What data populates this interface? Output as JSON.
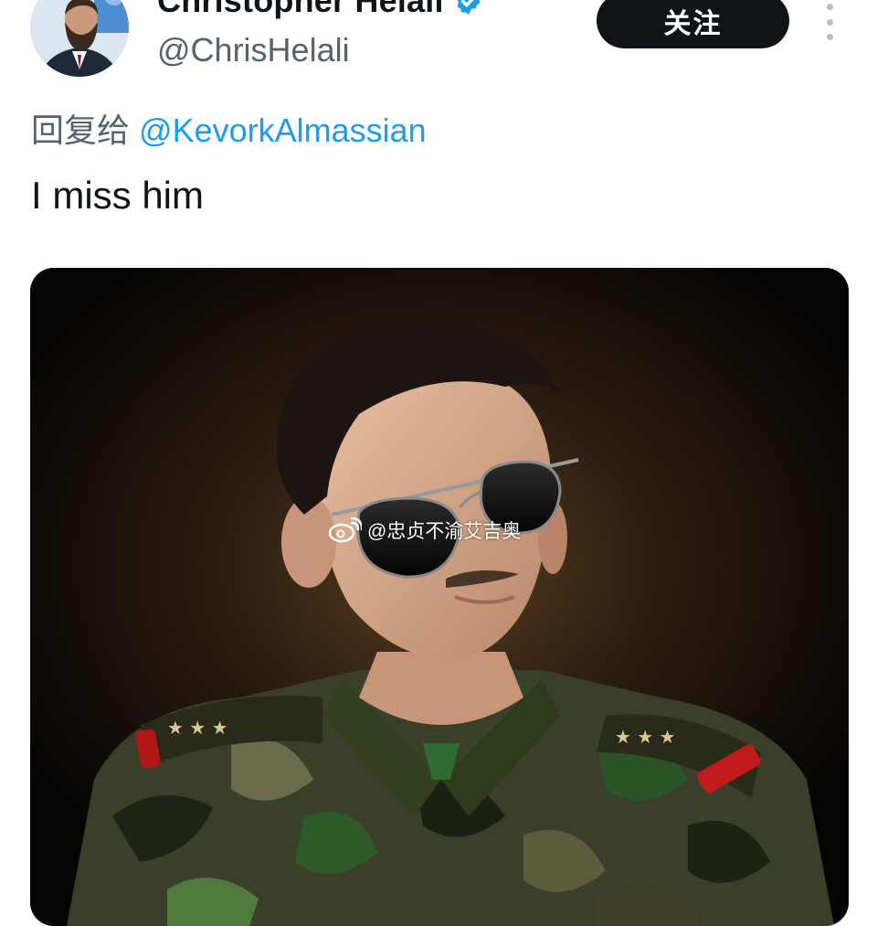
{
  "author": {
    "name": "Christopher Helali",
    "handle": "@ChrisHelali",
    "verified": true
  },
  "actions": {
    "follow_label": "关注",
    "more_icon": "more-vertical-icon"
  },
  "tweet": {
    "reply_prefix": "回复给",
    "reply_mention": "@KevorkAlmassian",
    "text": "I miss him"
  },
  "media": {
    "watermark_text": "@忠贞不渝艾吉奥",
    "watermark_icon": "weibo-icon"
  },
  "colors": {
    "link": "#1d9bf0",
    "verified": "#1d9bf0",
    "secondary_text": "#536471",
    "button_bg": "#0f1419"
  }
}
